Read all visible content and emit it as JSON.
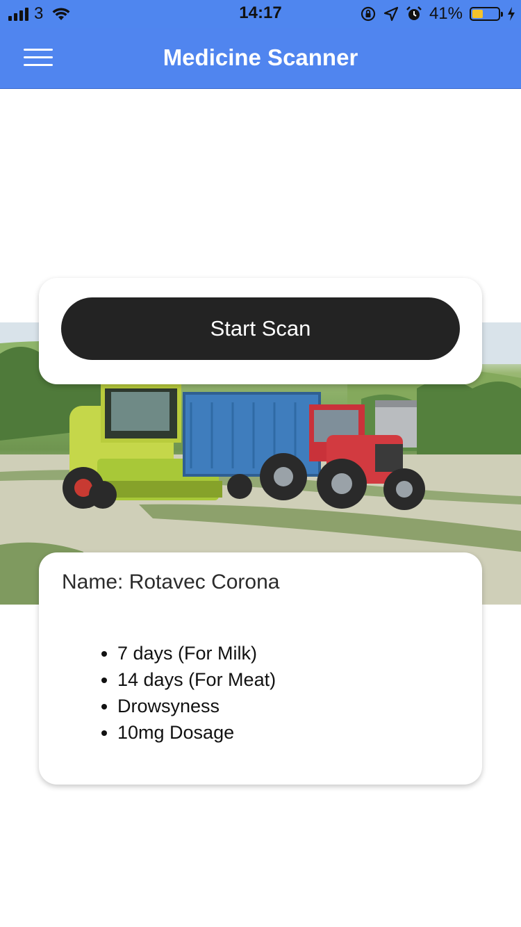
{
  "status_bar": {
    "carrier": "3",
    "time": "14:17",
    "battery_percent": "41%",
    "battery_level": 0.41,
    "battery_color": "#f5c42c",
    "icons": [
      "signal-icon",
      "wifi-icon",
      "orientation-lock-icon",
      "location-icon",
      "alarm-icon",
      "battery-icon",
      "charging-icon"
    ]
  },
  "app_bar": {
    "title": "Medicine Scanner",
    "menu_icon": "hamburger-menu-icon",
    "color": "#5085ef"
  },
  "scan": {
    "button_label": "Start Scan"
  },
  "medicine": {
    "name_line": "Name: Rotavec Corona",
    "details": [
      "7 days (For Milk)",
      "14 days (For Meat)",
      "Drowsyness",
      "10mg Dosage"
    ]
  }
}
